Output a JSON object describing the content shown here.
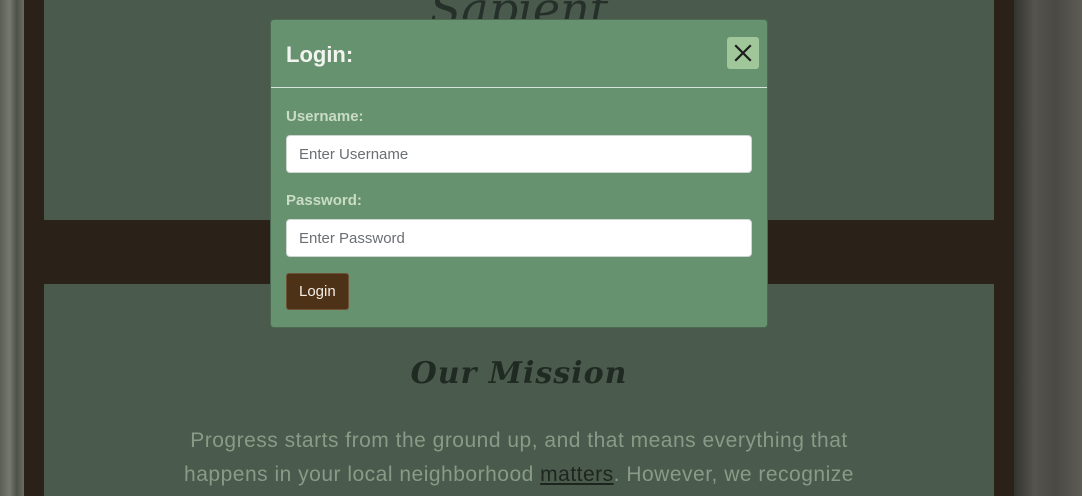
{
  "background": {
    "site_title": "Sapient",
    "mission_heading": "Our Mission",
    "mission_text_before": "Progress starts from the ground up, and that means everything that happens in your local neighborhood ",
    "mission_link": "matters",
    "mission_text_after": ". However, we recognize"
  },
  "modal": {
    "title": "Login:",
    "close_icon": "close-icon",
    "username_label": "Username:",
    "username_placeholder": "Enter Username",
    "username_value": "",
    "password_label": "Password:",
    "password_placeholder": "Enter Password",
    "password_value": "",
    "submit_label": "Login"
  },
  "colors": {
    "modal_bg": "#66926f",
    "button_bg": "#4d3218",
    "frame": "#2a2218",
    "panel": "#4a5a4c"
  }
}
